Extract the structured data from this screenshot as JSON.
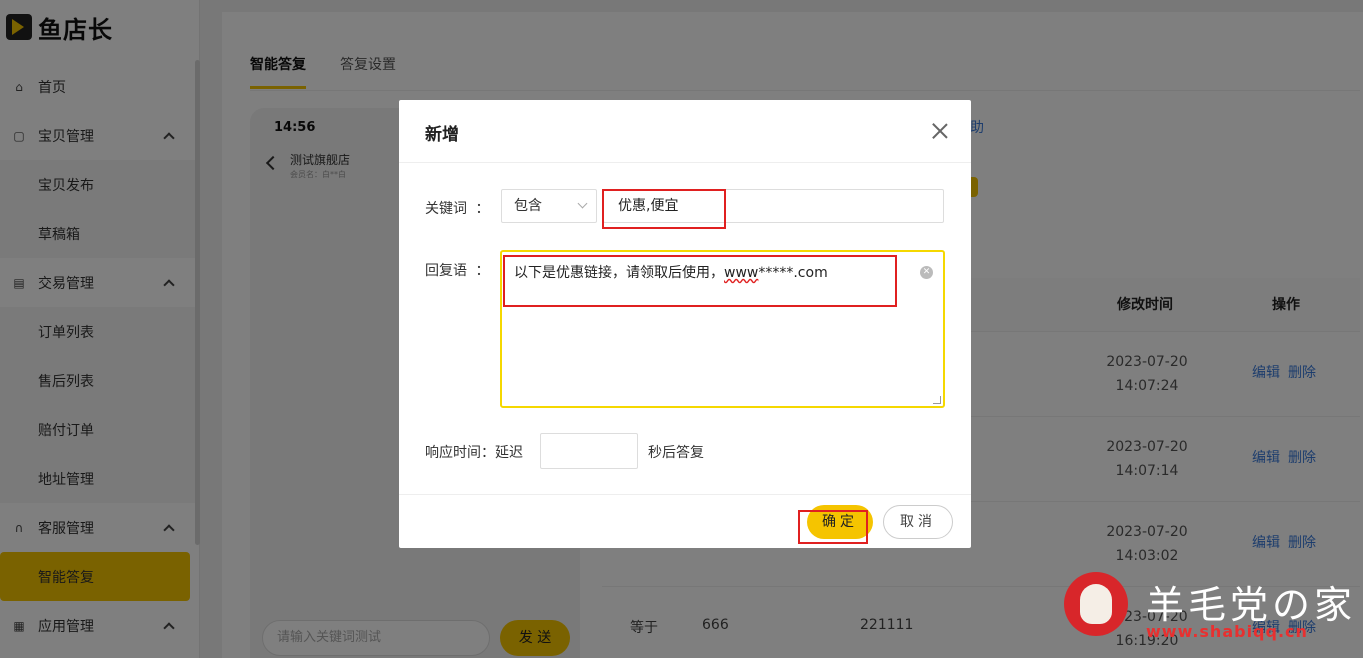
{
  "app": {
    "logo_text": "鱼店长"
  },
  "sidebar": {
    "items": [
      {
        "label": "首页",
        "icon": "home-icon"
      },
      {
        "label": "宝贝管理",
        "icon": "bag-icon"
      },
      {
        "label": "宝贝发布"
      },
      {
        "label": "草稿箱"
      },
      {
        "label": "交易管理",
        "icon": "list-icon"
      },
      {
        "label": "订单列表"
      },
      {
        "label": "售后列表"
      },
      {
        "label": "赔付订单"
      },
      {
        "label": "地址管理"
      },
      {
        "label": "客服管理",
        "icon": "headset-icon"
      },
      {
        "label": "智能答复",
        "active": true
      },
      {
        "label": "应用管理",
        "icon": "grid-icon"
      }
    ]
  },
  "tabs": [
    {
      "label": "智能答复",
      "active": true
    },
    {
      "label": "答复设置"
    }
  ],
  "phone": {
    "time": "14:56",
    "shop_name": "测试旗舰店",
    "member": "会员名：白**白",
    "input_placeholder": "请输入关键词测试",
    "send_label": "发 送"
  },
  "background": {
    "help_link": "助",
    "table_headers": {
      "modified_time": "修改时间",
      "actions": "操作"
    },
    "rows": [
      {
        "date": "2023-07-20",
        "time": "14:07:24",
        "edit": "编辑",
        "delete": "删除"
      },
      {
        "date": "2023-07-20",
        "time": "14:07:14",
        "edit": "编辑",
        "delete": "删除"
      },
      {
        "date": "2023-07-20",
        "time": "14:03:02",
        "edit": "编辑",
        "delete": "删除"
      },
      {
        "match": "等于",
        "keyword": "666",
        "reply": "221111",
        "date": "2023-07-20",
        "time": "16:19:20",
        "edit": "编辑",
        "delete": "删除"
      }
    ]
  },
  "modal": {
    "title": "新增",
    "keyword_label": "关键词",
    "match_type": "包含",
    "keyword_value": "优惠,便宜",
    "reply_label": "回复语",
    "reply_value_plain": "以下是优惠链接，请领取后使用，",
    "reply_value_underlined": "www",
    "reply_value_tail": "*****.com",
    "response_label": "响应时间：延迟",
    "delay_value": "",
    "delay_suffix": "秒后答复",
    "confirm_label": "确定",
    "cancel_label": "取消",
    "colon": "："
  },
  "watermark": {
    "text": "羊毛党の家",
    "url": "www.shabiqq.cn"
  },
  "colors": {
    "accent": "#f5c400",
    "link": "#3b7bdb",
    "highlight_red": "#e02020"
  }
}
